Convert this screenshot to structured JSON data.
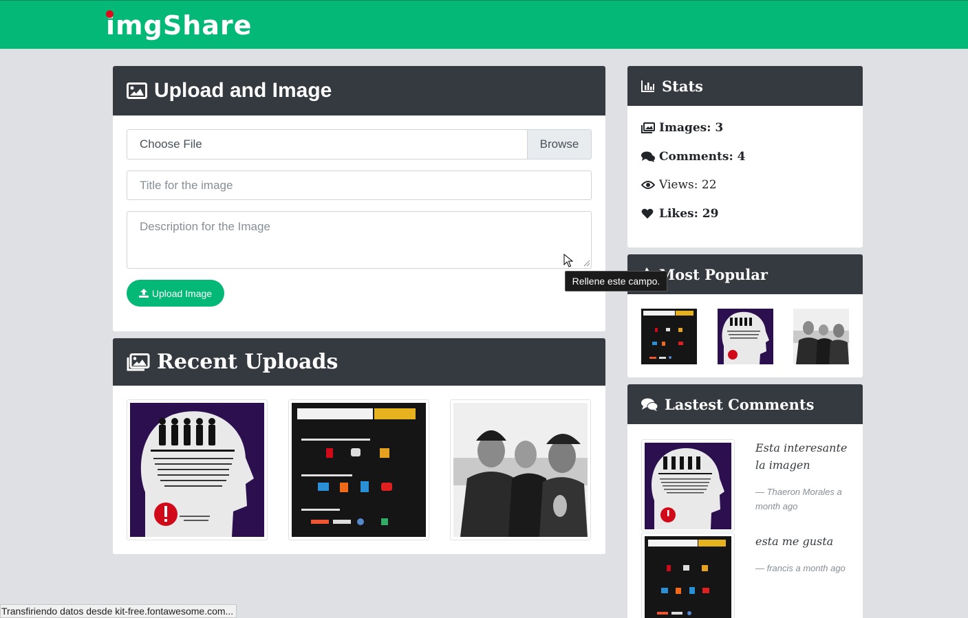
{
  "brand": {
    "name": "imgShare",
    "colors": {
      "primary": "#04b877",
      "dark": "#343a40",
      "dot": "#e00a1a"
    }
  },
  "upload": {
    "title": "Upload and Image",
    "file_label": "Choose File",
    "browse_label": "Browse",
    "title_placeholder": "Title for the image",
    "description_placeholder": "Description for the Image",
    "button_label": "Upload Image",
    "icons": {
      "header": "image-icon",
      "button": "upload-icon"
    }
  },
  "recent": {
    "title": "Recent Uploads",
    "icon": "images-icon",
    "items": [
      {
        "name": "identity-poster"
      },
      {
        "name": "internet-poster"
      },
      {
        "name": "three-men-photo"
      }
    ]
  },
  "stats": {
    "title": "Stats",
    "icon": "chart-bar-icon",
    "images_label": "Images: 3",
    "comments_label": "Comments: 4",
    "views_label": "Views: 22",
    "likes_label": "Likes: 29"
  },
  "popular": {
    "title": "Most Popular",
    "icon": "fire-icon"
  },
  "comments": {
    "title": "Lastest Comments",
    "icon": "comments-icon",
    "items": [
      {
        "text": "Esta interesante la imagen",
        "meta": "— Thaeron Morales a month ago"
      },
      {
        "text": "esta me gusta",
        "meta": "— francis a month ago"
      }
    ]
  },
  "tooltip": {
    "text": "Rellene este campo."
  },
  "status_bar": {
    "text": "Transfiriendo datos desde kit-free.fontawesome.com..."
  }
}
